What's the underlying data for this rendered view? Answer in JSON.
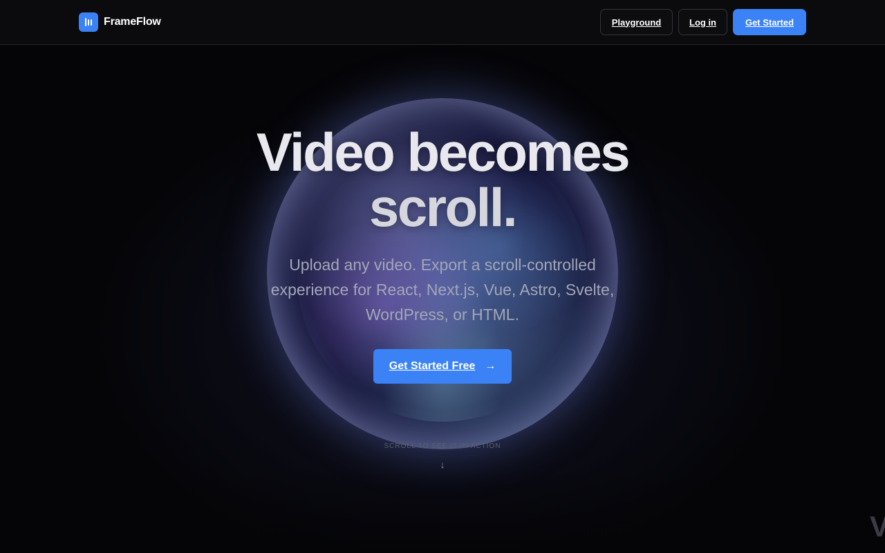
{
  "nav": {
    "brand": "FrameFlow",
    "playground_label": "Playground",
    "login_label": "Log in",
    "get_started_label": "Get Started"
  },
  "hero": {
    "title_line1": "Video becomes",
    "title_line2": "scroll.",
    "subtitle": "Upload any video. Export a scroll-controlled experience for React, Next.js, Vue, Astro, Svelte, WordPress, or HTML.",
    "cta_label": "Get Started Free",
    "cta_icon": "arrow-right-icon",
    "scroll_hint": "SCROLL TO SEE IT IN ACTION",
    "scroll_icon": "arrow-down-icon",
    "edge_glyph": "V"
  },
  "colors": {
    "accent": "#3b82f6",
    "background": "#050508",
    "nav_background": "#0b0b0d"
  }
}
